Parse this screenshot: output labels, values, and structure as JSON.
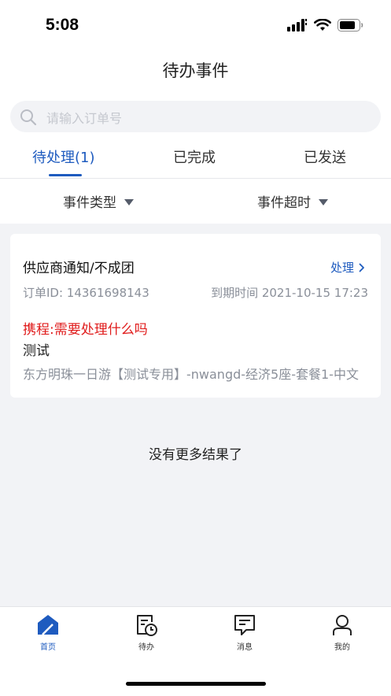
{
  "status_bar": {
    "time": "5:08"
  },
  "header": {
    "title": "待办事件"
  },
  "search": {
    "placeholder": "请输入订单号"
  },
  "tabs": [
    {
      "label": "待处理(1)",
      "active": true
    },
    {
      "label": "已完成",
      "active": false
    },
    {
      "label": "已发送",
      "active": false
    }
  ],
  "filters": [
    {
      "label": "事件类型"
    },
    {
      "label": "事件超时"
    }
  ],
  "events": [
    {
      "title": "供应商通知/不成团",
      "action": "处理",
      "order_id": "订单ID: 14361698143",
      "due": "到期时间 2021-10-15 17:23",
      "question": "携程:需要处理什么吗",
      "answer": "测试",
      "product": "东方明珠一日游【测试专用】-nwangd-经济5座-套餐1-中文"
    }
  ],
  "list_end": "没有更多结果了",
  "tabbar": [
    {
      "label": "首页",
      "icon": "home-icon",
      "active": true
    },
    {
      "label": "待办",
      "icon": "todo-clock-icon",
      "active": false
    },
    {
      "label": "消息",
      "icon": "message-icon",
      "active": false
    },
    {
      "label": "我的",
      "icon": "user-icon",
      "active": false
    }
  ],
  "colors": {
    "accent": "#1e5bbf",
    "alert": "#e01b1b",
    "muted": "#8a8f99",
    "background": "#f2f3f6"
  }
}
